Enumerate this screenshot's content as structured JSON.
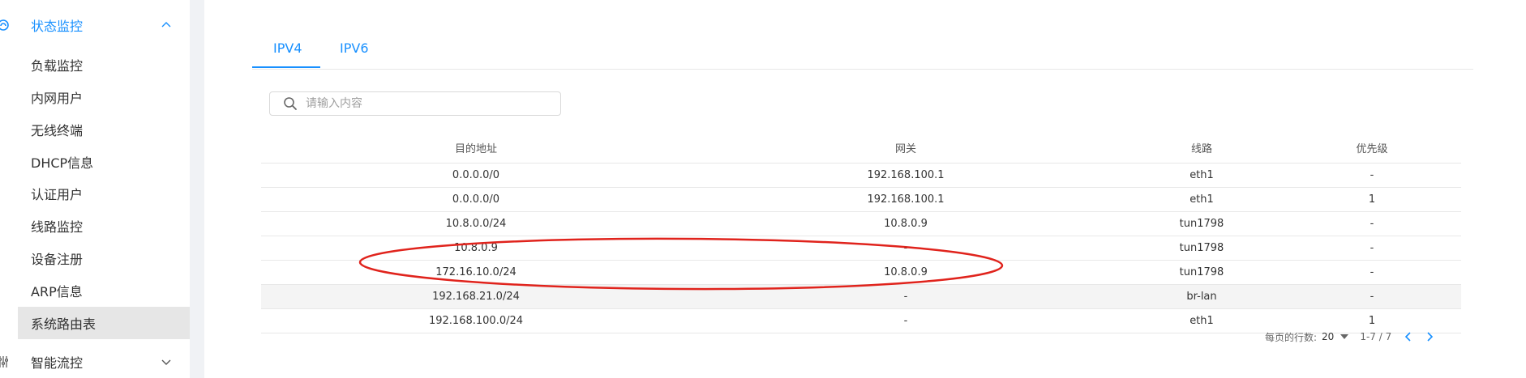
{
  "sidebar": {
    "group_status": {
      "label": "状态监控",
      "icon": "monitor-icon"
    },
    "items": [
      {
        "label": "负载监控"
      },
      {
        "label": "内网用户"
      },
      {
        "label": "无线终端"
      },
      {
        "label": "DHCP信息"
      },
      {
        "label": "认证用户"
      },
      {
        "label": "线路监控"
      },
      {
        "label": "设备注册"
      },
      {
        "label": "ARP信息"
      },
      {
        "label": "系统路由表"
      }
    ],
    "group_flow": {
      "label": "智能流控",
      "icon": "sliders-icon"
    }
  },
  "tabs": [
    {
      "label": "IPV4",
      "active": true
    },
    {
      "label": "IPV6",
      "active": false
    }
  ],
  "search": {
    "placeholder": "请输入内容"
  },
  "table": {
    "headers": [
      "目的地址",
      "网关",
      "线路",
      "优先级"
    ],
    "rows": [
      [
        "0.0.0.0/0",
        "192.168.100.1",
        "eth1",
        "-"
      ],
      [
        "0.0.0.0/0",
        "192.168.100.1",
        "eth1",
        "1"
      ],
      [
        "10.8.0.0/24",
        "10.8.0.9",
        "tun1798",
        "-"
      ],
      [
        "10.8.0.9",
        "-",
        "tun1798",
        "-"
      ],
      [
        "172.16.10.0/24",
        "10.8.0.9",
        "tun1798",
        "-"
      ],
      [
        "192.168.21.0/24",
        "-",
        "br-lan",
        "-"
      ],
      [
        "192.168.100.0/24",
        "-",
        "eth1",
        "1"
      ]
    ]
  },
  "pagination": {
    "rows_per_page_label": "每页的行数:",
    "rows_per_page": "20",
    "range": "1-7 / 7"
  },
  "colors": {
    "accent": "#1890ff",
    "annotation": "#e0231c",
    "active_bg": "#e6e6e6"
  }
}
